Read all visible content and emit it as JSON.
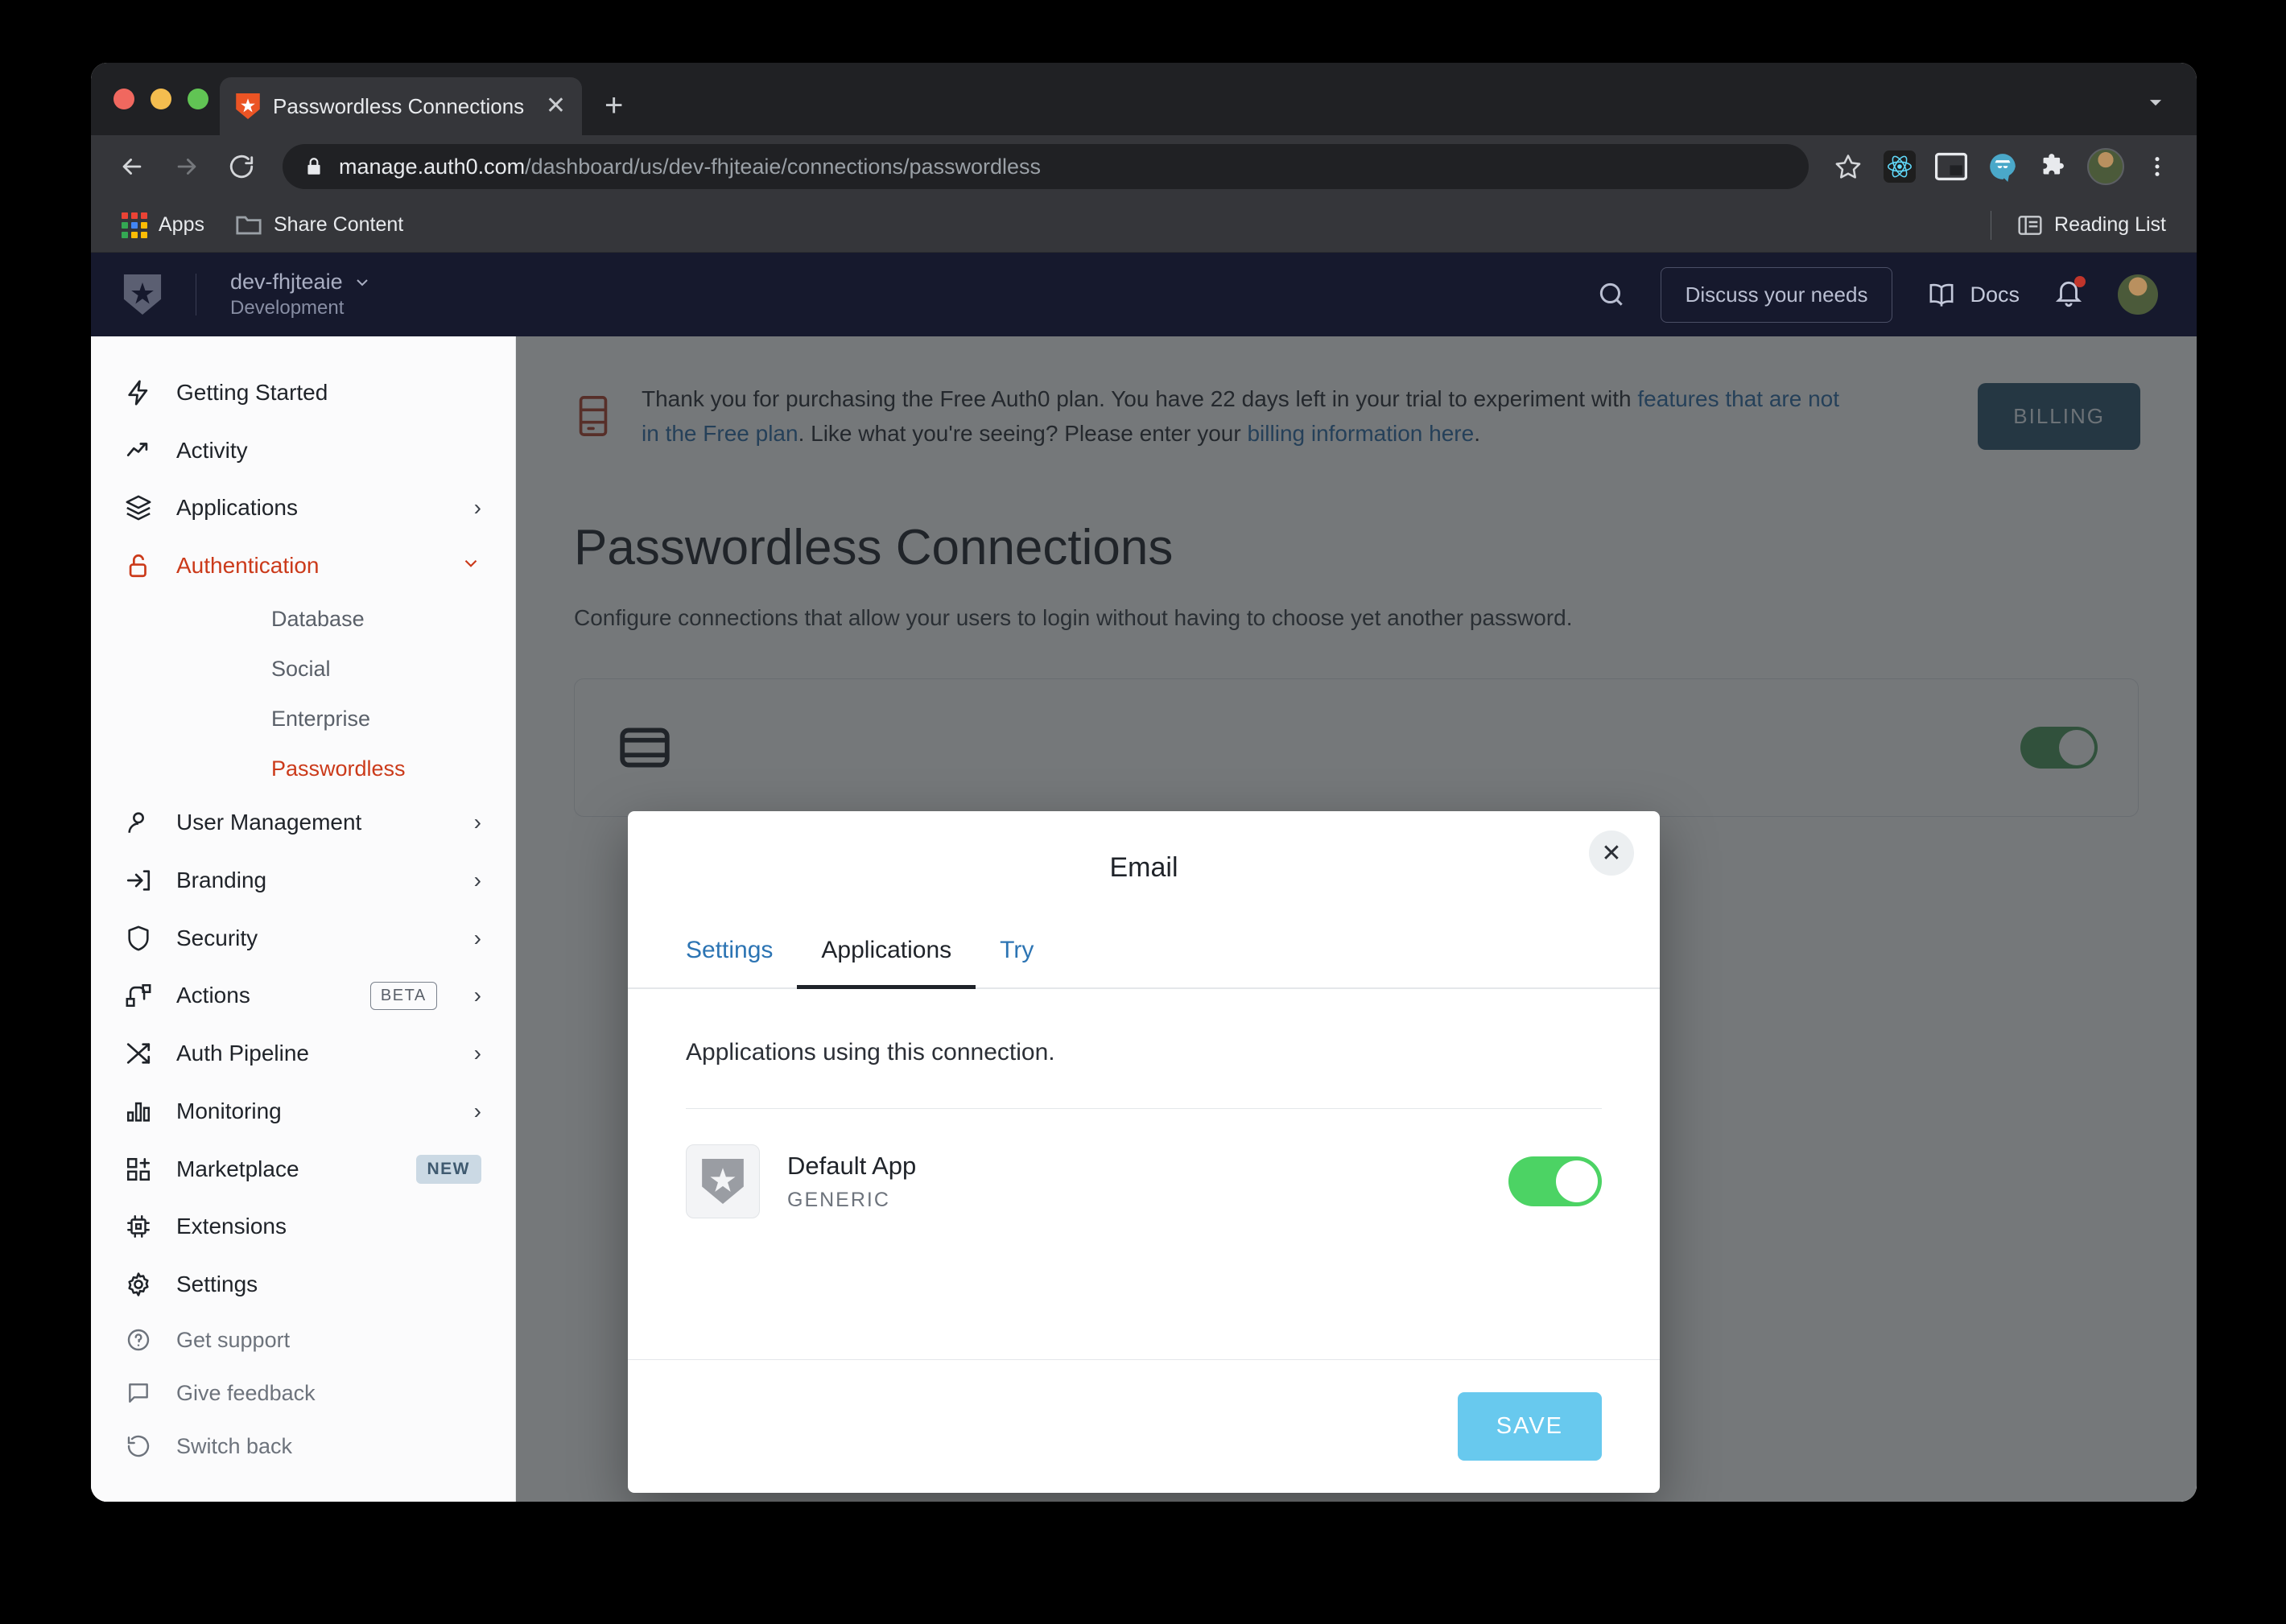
{
  "browser": {
    "tab": {
      "title": "Passwordless Connections",
      "favicon": "auth0-logo-icon",
      "close": "✕",
      "new_tab": "+"
    },
    "nav": {
      "back": "←",
      "forward": "→",
      "reload": "⟳"
    },
    "omnibox": {
      "lock": "lock-icon",
      "url_host": "manage.auth0.com",
      "url_path": "/dashboard/us/dev-fhjteaie/connections/passwordless"
    },
    "toolbar_icons": [
      "bookmark-star-icon",
      "react-devtools-icon",
      "picture-in-picture-icon",
      "privacy-badger-icon",
      "extensions-puzzle-icon",
      "profile-avatar",
      "chrome-menu-icon"
    ],
    "bookmarks": [
      {
        "label": "Apps",
        "icon": "apps-grid-icon"
      },
      {
        "label": "Share Content",
        "icon": "folder-icon"
      }
    ],
    "reading_list": {
      "label": "Reading List",
      "icon": "reading-list-icon"
    },
    "window_menu_icon": "dropdown-caret-icon"
  },
  "app_header": {
    "logo": "auth0-logo-icon",
    "tenant_name": "dev-fhjteaie",
    "tenant_env": "Development",
    "tenant_caret": "⌄",
    "search_icon": "search-icon",
    "discuss_button": "Discuss your needs",
    "docs_label": "Docs",
    "docs_icon": "book-icon",
    "notifications_icon": "bell-icon",
    "avatar": "user-avatar"
  },
  "sidebar": {
    "items": [
      {
        "label": "Getting Started",
        "icon": "lightning-icon",
        "chevron": "",
        "badge": ""
      },
      {
        "label": "Activity",
        "icon": "trend-up-icon",
        "chevron": "",
        "badge": ""
      },
      {
        "label": "Applications",
        "icon": "layers-icon",
        "chevron": "›",
        "badge": ""
      },
      {
        "label": "Authentication",
        "icon": "unlock-icon",
        "chevron": "⌄",
        "badge": "",
        "active": true
      },
      {
        "label": "User Management",
        "icon": "user-icon",
        "chevron": "›",
        "badge": ""
      },
      {
        "label": "Branding",
        "icon": "login-arrow-icon",
        "chevron": "›",
        "badge": ""
      },
      {
        "label": "Security",
        "icon": "shield-icon",
        "chevron": "›",
        "badge": ""
      },
      {
        "label": "Actions",
        "icon": "actions-flow-icon",
        "chevron": "›",
        "badge": "BETA"
      },
      {
        "label": "Auth Pipeline",
        "icon": "shuffle-icon",
        "chevron": "›",
        "badge": ""
      },
      {
        "label": "Monitoring",
        "icon": "bar-chart-icon",
        "chevron": "›",
        "badge": ""
      },
      {
        "label": "Marketplace",
        "icon": "grid-plus-icon",
        "chevron": "",
        "badge": "NEW"
      },
      {
        "label": "Extensions",
        "icon": "chip-icon",
        "chevron": "",
        "badge": ""
      },
      {
        "label": "Settings",
        "icon": "gear-icon",
        "chevron": "",
        "badge": ""
      }
    ],
    "sub_items": [
      {
        "label": "Database"
      },
      {
        "label": "Social"
      },
      {
        "label": "Enterprise"
      },
      {
        "label": "Passwordless",
        "active": true
      }
    ],
    "footer": [
      {
        "label": "Get support",
        "icon": "question-circle-icon"
      },
      {
        "label": "Give feedback",
        "icon": "chat-bubble-icon"
      },
      {
        "label": "Switch back",
        "icon": "undo-icon"
      }
    ]
  },
  "banner": {
    "icon": "server-icon",
    "text_1": "Thank you for purchasing the Free Auth0 plan. You have 22 days left in your trial to experiment with ",
    "link_1": "features that are not in the Free plan",
    "text_2": ". Like what you're seeing? Please enter your ",
    "link_2": "billing information here",
    "text_3": ".",
    "billing_button": "BILLING"
  },
  "page": {
    "title": "Passwordless Connections",
    "description": "Configure connections that allow your users to login without having to choose yet another password.",
    "connection_icon": "email-icon",
    "connection_toggle_state": "on"
  },
  "modal": {
    "title": "Email",
    "close": "✕",
    "tabs": [
      {
        "label": "Settings",
        "active": false
      },
      {
        "label": "Applications",
        "active": true
      },
      {
        "label": "Try",
        "active": false
      }
    ],
    "lead": "Applications using this connection.",
    "application": {
      "icon": "auth0-logo-icon",
      "name": "Default App",
      "type": "GENERIC",
      "toggle_state": "on"
    },
    "save_button": "SAVE"
  },
  "colors": {
    "accent_orange": "#cb3a1a",
    "link_blue": "#2c74b3",
    "save_blue": "#68c9ee",
    "toggle_green": "#4cd364",
    "billing_blue": "#2f5470",
    "header_dark": "#16192d"
  }
}
